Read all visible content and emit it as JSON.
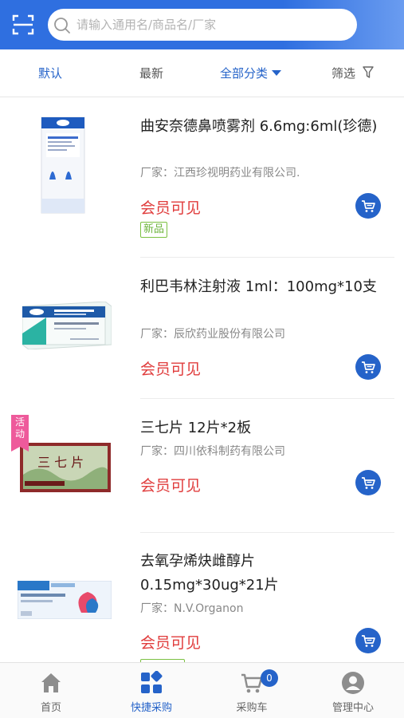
{
  "search": {
    "placeholder": "请输入通用名/商品名/厂家"
  },
  "tabs": {
    "default": "默认",
    "newest": "最新",
    "category": "全部分类",
    "filter": "筛选"
  },
  "products": [
    {
      "name": "曲安奈德鼻喷雾剂 6.6mg:6ml(珍德)",
      "maker": "厂家：江西珍视明药业有限公司.",
      "price": "会员可见",
      "badge": "新品"
    },
    {
      "name": "利巴韦林注射液 1ml：100mg*10支",
      "maker": "厂家：辰欣药业股份有限公司",
      "price": "会员可见"
    },
    {
      "name": "三七片 12片*2板",
      "maker": "厂家：四川依科制药有限公司",
      "price": "会员可见",
      "promo": "活动"
    },
    {
      "name": "去氧孕烯炔雌醇片 0.15mg*30ug*21片",
      "maker": "厂家：N.V.Organon",
      "price": "会员可见"
    }
  ],
  "nav": {
    "home": "首页",
    "quick": "快捷采购",
    "cart": "采购车",
    "cart_count": "0",
    "manage": "管理中心"
  },
  "colors": {
    "primary": "#2563c9",
    "price": "#e03c3c",
    "new_badge": "#6bb33a"
  }
}
